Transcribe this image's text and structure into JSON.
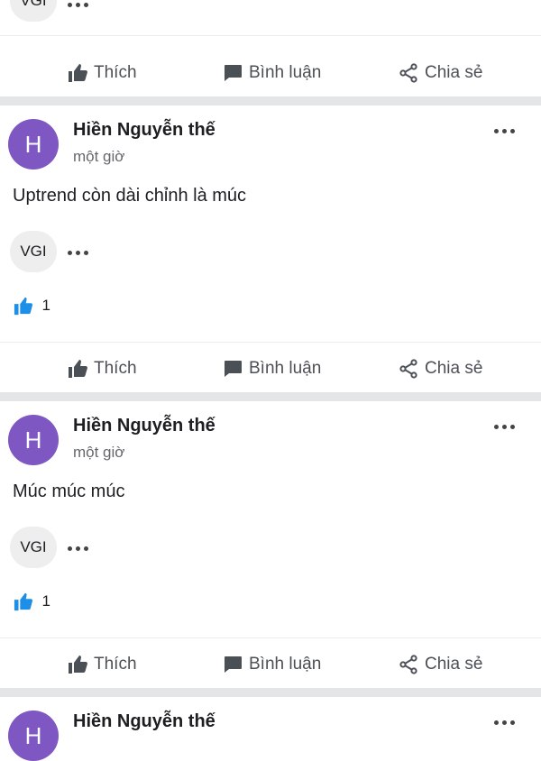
{
  "actions": {
    "like": "Thích",
    "comment": "Bình luận",
    "share": "Chia sẻ"
  },
  "top_tag": "VGI",
  "posts": [
    {
      "author": "Hiền Nguyễn thế",
      "time": "một giờ",
      "content": "Uptrend còn dài chỉnh là múc",
      "tag": "VGI",
      "likes": "1",
      "avatar_initial": "H"
    },
    {
      "author": "Hiền Nguyễn thế",
      "time": "một giờ",
      "content": "Múc múc múc",
      "tag": "VGI",
      "likes": "1",
      "avatar_initial": "H"
    },
    {
      "author": "Hiền Nguyễn thế",
      "avatar_initial": "H"
    }
  ],
  "colors": {
    "avatar": "#7e57c2",
    "like_blue": "#1e8fe6",
    "separator": "#e4e5e7"
  },
  "icons": [
    "thumbs-up-icon",
    "comment-icon",
    "share-icon",
    "more-dots-icon",
    "thumbs-up-filled-icon"
  ]
}
